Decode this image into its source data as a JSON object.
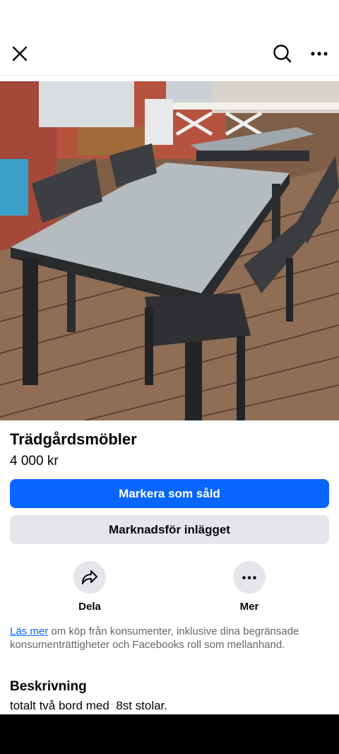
{
  "header": {
    "close_icon": "close-icon",
    "search_icon": "search-icon",
    "more_icon": "more-icon"
  },
  "listing": {
    "title": "Trädgårdsmöbler",
    "price": "4 000 kr",
    "primary_button": "Markera som såld",
    "secondary_button": "Marknadsför inlägget"
  },
  "actions": [
    {
      "label": "Dela",
      "icon": "share-icon"
    },
    {
      "label": "Mer",
      "icon": "more-icon"
    }
  ],
  "disclaimer": {
    "link": "Läs mer",
    "text": " om köp från konsumenter, inklusive dina begränsade konsumenträttigheter och Facebooks roll som mellanhand."
  },
  "description": {
    "heading": "Beskrivning",
    "text": "totalt två bord med  8st stolar."
  },
  "colors": {
    "accent": "#0866ff",
    "secondary_bg": "#e4e6eb",
    "muted_text": "#65676b"
  }
}
